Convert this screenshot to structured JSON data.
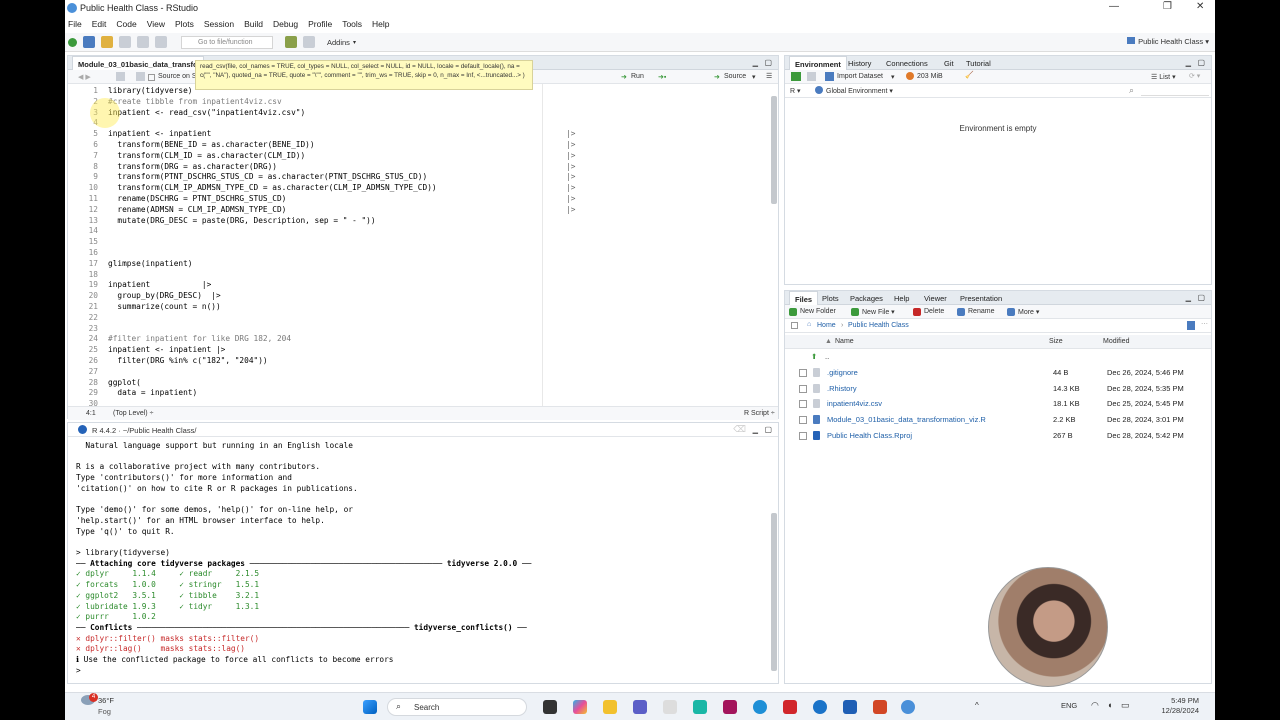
{
  "window": {
    "title": "Public Health Class - RStudio",
    "min": "—",
    "max": "❐",
    "close": "✕"
  },
  "menu": [
    "File",
    "Edit",
    "Code",
    "View",
    "Plots",
    "Session",
    "Build",
    "Debug",
    "Profile",
    "Tools",
    "Help"
  ],
  "toolbar": {
    "goto_placeholder": "Go to file/function",
    "addins": "Addins",
    "project": "Public Health Class"
  },
  "editor": {
    "tab": "Module_03_01basic_data_transfor",
    "source_on_save": "Source on Sa",
    "run": "Run",
    "source": "Source",
    "tooltip": "read_csv(file, col_names = TRUE, col_types = NULL, col_select = NULL, id = NULL, locale = default_locale(), na = c(\"\", \"NA\"), quoted_na = TRUE, quote = \"\\\"\", comment = \"\", trim_ws = TRUE, skip = 0, n_max = Inf, <...truncated...> )",
    "lines": [
      {
        "n": "1",
        "t": "library(tidyverse)",
        "p": ""
      },
      {
        "n": "2",
        "t": "#create tibble from inpatient4viz.csv",
        "p": "",
        "c": "comment"
      },
      {
        "n": "3",
        "t": "inpatient <- read_csv(\"inpatient4viz.csv\")",
        "p": ""
      },
      {
        "n": "4",
        "t": "",
        "p": ""
      },
      {
        "n": "5",
        "t": "inpatient <- inpatient",
        "p": "|>"
      },
      {
        "n": "6",
        "t": "  transform(BENE_ID = as.character(BENE_ID))",
        "p": "|>"
      },
      {
        "n": "7",
        "t": "  transform(CLM_ID = as.character(CLM_ID))",
        "p": "|>"
      },
      {
        "n": "8",
        "t": "  transform(DRG = as.character(DRG))",
        "p": "|>"
      },
      {
        "n": "9",
        "t": "  transform(PTNT_DSCHRG_STUS_CD = as.character(PTNT_DSCHRG_STUS_CD))",
        "p": "|>"
      },
      {
        "n": "10",
        "t": "  transform(CLM_IP_ADMSN_TYPE_CD = as.character(CLM_IP_ADMSN_TYPE_CD))",
        "p": "|>"
      },
      {
        "n": "11",
        "t": "  rename(DSCHRG = PTNT_DSCHRG_STUS_CD)",
        "p": "|>"
      },
      {
        "n": "12",
        "t": "  rename(ADMSN = CLM_IP_ADMSN_TYPE_CD)",
        "p": "|>"
      },
      {
        "n": "13",
        "t": "  mutate(DRG_DESC = paste(DRG, Description, sep = \" - \"))",
        "p": ""
      },
      {
        "n": "14",
        "t": "",
        "p": ""
      },
      {
        "n": "15",
        "t": "",
        "p": ""
      },
      {
        "n": "16",
        "t": "",
        "p": ""
      },
      {
        "n": "17",
        "t": "glimpse(inpatient)",
        "p": ""
      },
      {
        "n": "18",
        "t": "",
        "p": ""
      },
      {
        "n": "19",
        "t": "inpatient           |>",
        "p": ""
      },
      {
        "n": "20",
        "t": "  group_by(DRG_DESC)  |>",
        "p": ""
      },
      {
        "n": "21",
        "t": "  summarize(count = n())",
        "p": ""
      },
      {
        "n": "22",
        "t": "",
        "p": ""
      },
      {
        "n": "23",
        "t": "",
        "p": ""
      },
      {
        "n": "24",
        "t": "#filter inpatient for like DRG 182, 204",
        "p": "",
        "c": "comment"
      },
      {
        "n": "25",
        "t": "inpatient <- inpatient |>",
        "p": ""
      },
      {
        "n": "26",
        "t": "  filter(DRG %in% c(\"182\", \"204\"))",
        "p": ""
      },
      {
        "n": "27",
        "t": "",
        "p": ""
      },
      {
        "n": "28",
        "t": "ggplot(",
        "p": ""
      },
      {
        "n": "29",
        "t": "  data = inpatient)",
        "p": ""
      },
      {
        "n": "30",
        "t": "",
        "p": ""
      }
    ],
    "status_pos": "4:1",
    "status_scope": "(Top Level) ÷",
    "status_type": "R Script ÷"
  },
  "console": {
    "header": "R 4.4.2 · ~/Public Health Class/",
    "lines": [
      {
        "t": "  Natural language support but running in an English locale"
      },
      {
        "t": ""
      },
      {
        "t": "R is a collaborative project with many contributors."
      },
      {
        "t": "Type 'contributors()' for more information and"
      },
      {
        "t": "'citation()' on how to cite R or R packages in publications."
      },
      {
        "t": ""
      },
      {
        "t": "Type 'demo()' for some demos, 'help()' for on-line help, or"
      },
      {
        "t": "'help.start()' for an HTML browser interface to help."
      },
      {
        "t": "Type 'q()' to quit R."
      },
      {
        "t": ""
      },
      {
        "t": "> library(tidyverse)"
      },
      {
        "t": "── Attaching core tidyverse packages ───────────────────────────────────────── tidyverse 2.0.0 ──",
        "b": true
      },
      {
        "t": "✓ dplyr     1.1.4     ✓ readr     2.1.5",
        "c": "ok"
      },
      {
        "t": "✓ forcats   1.0.0     ✓ stringr   1.5.1",
        "c": "ok"
      },
      {
        "t": "✓ ggplot2   3.5.1     ✓ tibble    3.2.1",
        "c": "ok"
      },
      {
        "t": "✓ lubridate 1.9.3     ✓ tidyr     1.3.1",
        "c": "ok"
      },
      {
        "t": "✓ purrr     1.0.2",
        "c": "ok"
      },
      {
        "t": "── Conflicts ────────────────────────────────────────────────────────── tidyverse_conflicts() ──",
        "b": true
      },
      {
        "t": "✕ dplyr::filter() masks stats::filter()",
        "c": "bad"
      },
      {
        "t": "✕ dplyr::lag()    masks stats::lag()",
        "c": "bad"
      },
      {
        "t": "ℹ Use the conflicted package to force all conflicts to become errors"
      },
      {
        "t": ">"
      }
    ]
  },
  "env": {
    "tabs": [
      "Environment",
      "History",
      "Connections",
      "Git",
      "Tutorial"
    ],
    "import": "Import Dataset",
    "memory": "203 MiB",
    "view": "List",
    "lang": "R",
    "scope": "Global Environment",
    "empty": "Environment is empty"
  },
  "files": {
    "tabs": [
      "Files",
      "Plots",
      "Packages",
      "Help",
      "Viewer",
      "Presentation"
    ],
    "actions": [
      "New Folder",
      "New File",
      "Delete",
      "Rename",
      "More"
    ],
    "crumb_home": "Home",
    "crumb_dir": "Public Health Class",
    "cols": {
      "name": "Name",
      "size": "Size",
      "modified": "Modified"
    },
    "up": "..",
    "rows": [
      {
        "name": ".gitignore",
        "size": "44 B",
        "mod": "Dec 26, 2024, 5:46 PM"
      },
      {
        "name": ".Rhistory",
        "size": "14.3 KB",
        "mod": "Dec 28, 2024, 5:35 PM"
      },
      {
        "name": "inpatient4viz.csv",
        "size": "18.1 KB",
        "mod": "Dec 25, 2024, 5:45 PM"
      },
      {
        "name": "Module_03_01basic_data_transformation_viz.R",
        "size": "2.2 KB",
        "mod": "Dec 28, 2024, 3:01 PM"
      },
      {
        "name": "Public Health Class.Rproj",
        "size": "267 B",
        "mod": "Dec 28, 2024, 5:42 PM"
      }
    ]
  },
  "taskbar": {
    "weather_temp": "36°F",
    "weather_desc": "Fog",
    "search": "Search",
    "lang": "ENG",
    "time": "5:49 PM",
    "date": "12/28/2024",
    "badge": "4"
  }
}
